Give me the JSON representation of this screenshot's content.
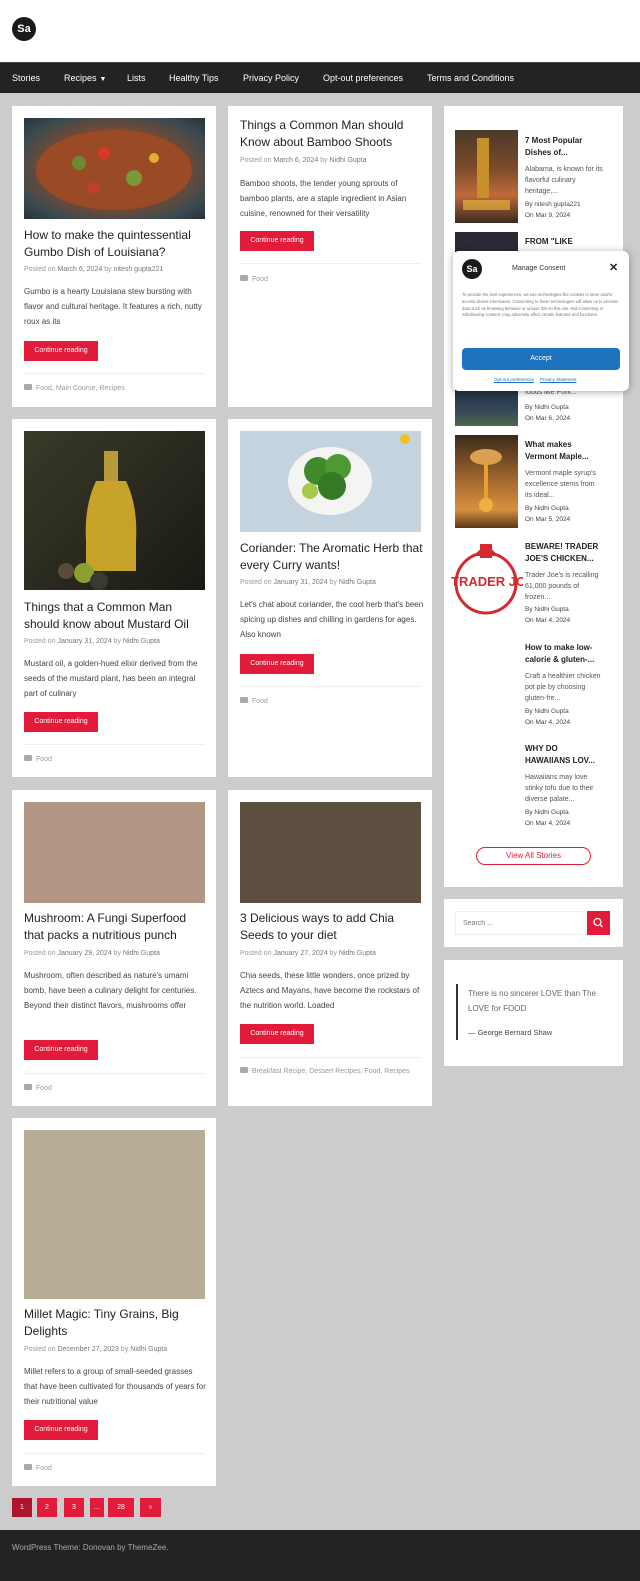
{
  "site": {
    "logo_text": "Sa"
  },
  "nav": {
    "items": [
      "Stories",
      "Recipes",
      "Lists",
      "Healthy Tips",
      "Privacy Policy",
      "Opt-out preferences",
      "Terms and Conditions"
    ]
  },
  "posts": [
    {
      "title": "How to make the quintessential Gumbo Dish of Louisiana?",
      "meta_prefix": "Posted on",
      "date": "March 6, 2024",
      "by": "by",
      "author": "nitesh gupta221",
      "excerpt": "Gumbo is a hearty Louisiana stew bursting with flavor and cultural heritage. It features a rich, nutty roux as its",
      "button": "Continue reading",
      "categories": "Food, Main Course, Recipes",
      "image_color": "#8a4a2a"
    },
    {
      "title": "Things a Common Man should Know about Bamboo Shoots",
      "meta_prefix": "Posted on",
      "date": "March 6, 2024",
      "by": "by",
      "author": "Nidhi Gupta",
      "excerpt": "Bamboo shoots, the tender young sprouts of bamboo plants, are a staple ingredient in Asian cuisine, renowned for their versatility",
      "button": "Continue reading",
      "categories": "Food"
    },
    {
      "title": "Things that a Common Man should know about Mustard Oil",
      "meta_prefix": "Posted on",
      "date": "January 31, 2024",
      "by": "by",
      "author": "Nidhi Gupta",
      "excerpt": "Mustard oil, a golden-hued elixir derived from the seeds of the mustard plant, has been an integral part of culinary",
      "button": "Continue reading",
      "categories": "Food",
      "image_color": "#2a2a20"
    },
    {
      "title": "Coriander: The Aromatic Herb that every Curry wants!",
      "meta_prefix": "Posted on",
      "date": "January 31, 2024",
      "by": "by",
      "author": "Nidhi Gupta",
      "excerpt": "Let's chat about coriander, the cool herb that's been spicing up dishes and chilling in gardens for ages. Also known",
      "button": "Continue reading",
      "categories": "Food",
      "image_color": "#c5d3de"
    },
    {
      "title": "Mushroom: A Fungi Superfood that packs a nutritious punch",
      "meta_prefix": "Posted on",
      "date": "January 29, 2024",
      "by": "by",
      "author": "Nidhi Gupta",
      "excerpt": "Mushroom, often described as nature's umami bomb, have been a culinary delight for centuries. Beyond their distinct flavors, mushrooms offer",
      "button": "Continue reading",
      "categories": "Food",
      "image_color": "#b29582"
    },
    {
      "title": "3 Delicious ways to add Chia Seeds to your diet",
      "meta_prefix": "Posted on",
      "date": "January 27, 2024",
      "by": "by",
      "author": "Nidhi Gupta",
      "excerpt": "Chia seeds, these little wonders, once prized by Aztecs and Mayans, have become the rockstars of the nutrition world. Loaded",
      "button": "Continue reading",
      "categories": "Breakfast Recipe, Dessert Recipes, Food, Recipes",
      "image_color": "#5d4f40"
    },
    {
      "title": "Millet Magic: Tiny Grains, Big Delights",
      "meta_prefix": "Posted on",
      "date": "December 27, 2023",
      "by": "by",
      "author": "Nidhi Gupta",
      "excerpt": "Millet refers to a group of small-seeded grasses that have been cultivated for thousands of years for their nutritional value",
      "button": "Continue reading",
      "categories": "Food",
      "image_color": "#b7ad94"
    }
  ],
  "sidebar": {
    "stories": [
      {
        "title": "7 Most Popular Dishes of...",
        "excerpt": "Alabama, is known for its flavorful culinary heritage,...",
        "author": "By nitesh gupta221",
        "date": "On Mar 9, 2024",
        "image_color": "#6a3f2a"
      },
      {
        "title": "FROM \"LIKE",
        "image_color": "#2a2a35"
      },
      {
        "excerpt": "foods like Pork...",
        "author": "By Nidhi Gupta",
        "date": "On Mar 6, 2024",
        "image_color": "#34455a"
      },
      {
        "title": "What makes Vermont Maple...",
        "excerpt": "Vermont maple syrup's excellence stems from its ideal...",
        "author": "By Nidhi Gupta",
        "date": "On Mar 5, 2024",
        "image_color": "#a86a30"
      },
      {
        "title": "BEWARE! TRADER JOE'S CHICKEN...",
        "excerpt": "Trader Joe's is recalling 61,000 pounds of frozen...",
        "author": "By Nidhi Gupta",
        "date": "On Mar 4, 2024",
        "logo_text": "TRADER JOE'S",
        "accent": "#d42a2f"
      },
      {
        "title": "How to make low-calorie & gluten-...",
        "excerpt": "Craft a healthier chicken pot pie by choosing gluten-fre...",
        "author": "By Nidhi Gupta",
        "date": "On Mar 4, 2024"
      },
      {
        "title": "WHY DO HAWAIIANS LOV...",
        "excerpt": "Hawaiians may love stinky tofu due to their diverse palate...",
        "author": "By Nidhi Gupta",
        "date": "On Mar 4, 2024"
      }
    ],
    "view_all": "View All Stories"
  },
  "search": {
    "placeholder": "Search ..."
  },
  "quote": {
    "text": "There is no sincerer LOVE than The LOVE for FOOD",
    "cite": "— George Bernard Shaw"
  },
  "consent": {
    "title": "Manage Consent",
    "close": "✕",
    "body": "To provide the best experiences, we use technologies like cookies to store and/or access device information. Consenting to these technologies will allow us to process data such as browsing behavior or unique IDs on this site. Not consenting or withdrawing consent, may adversely affect certain features and functions.",
    "accept": "Accept",
    "optout": "Opt-out preferences",
    "privacy": "Privacy Statement"
  },
  "pagination": [
    "1",
    "2",
    "3",
    "…",
    "28",
    "»"
  ],
  "footer": {
    "text": "WordPress Theme: Donovan by ThemeZee."
  },
  "colors": {
    "accent": "#e31b3b",
    "nav_bg": "#232323",
    "page_bg": "#cccccc",
    "consent_button": "#1e73be"
  }
}
